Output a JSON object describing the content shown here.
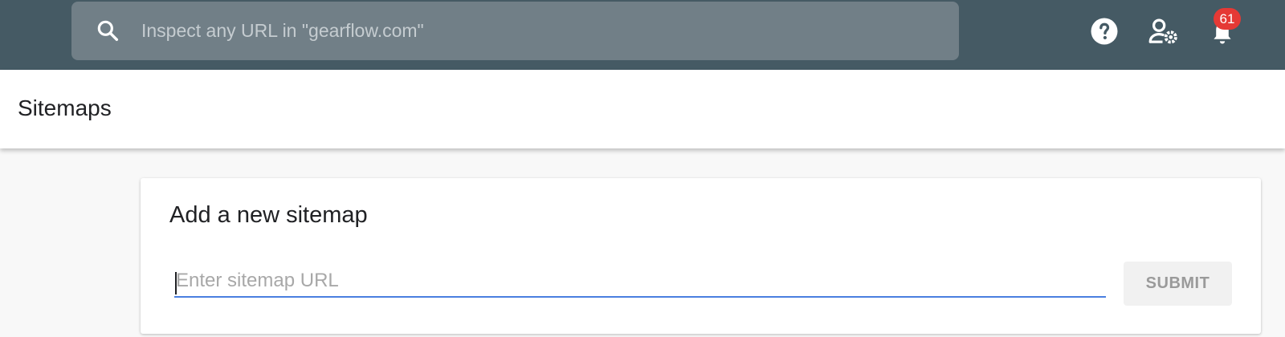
{
  "header": {
    "search": {
      "icon": "search-icon",
      "placeholder": "Inspect any URL in \"gearflow.com\""
    },
    "actions": [
      {
        "icon": "help-icon"
      },
      {
        "icon": "admin-settings-icon"
      },
      {
        "icon": "notifications-bell-icon"
      }
    ],
    "notification_count": "61",
    "colors": {
      "topbar": "#455a64",
      "search_bg": "#717f87",
      "badge": "#e53935"
    }
  },
  "page": {
    "title": "Sitemaps"
  },
  "card": {
    "title": "Add a new sitemap",
    "input": {
      "placeholder": "Enter sitemap URL",
      "value": ""
    },
    "submit_label": "SUBMIT",
    "colors": {
      "input_underline": "#4a7fe0"
    }
  }
}
